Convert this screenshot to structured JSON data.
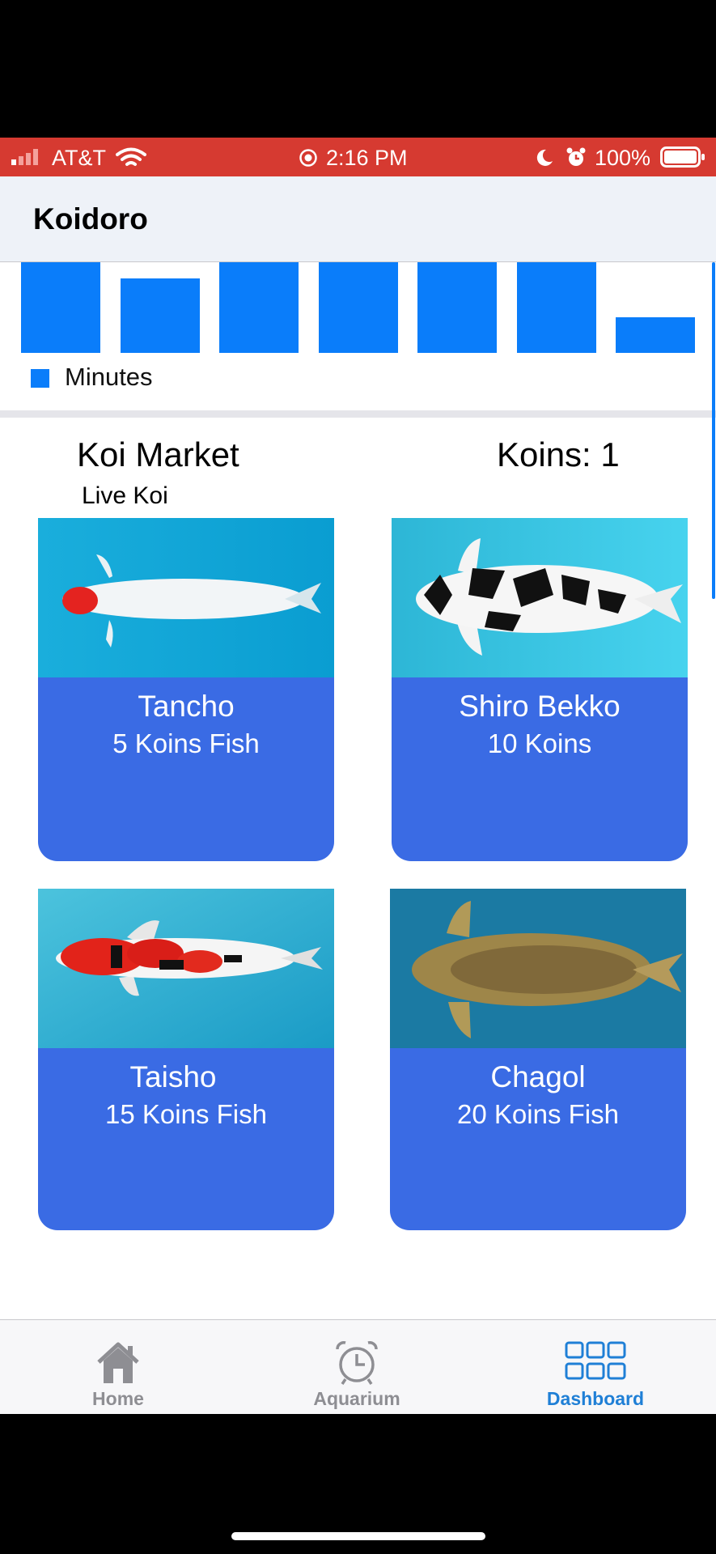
{
  "status_bar": {
    "carrier": "AT&T",
    "time": "2:16 PM",
    "battery": "100%",
    "icons": [
      "signal-icon",
      "wifi-icon",
      "location-icon",
      "moon-icon",
      "alarm-icon",
      "battery-icon"
    ]
  },
  "nav": {
    "title": "Koidoro"
  },
  "chart_data": {
    "type": "bar",
    "categories": [
      "",
      "",
      "",
      "",
      "",
      "",
      ""
    ],
    "series": [
      {
        "name": "Minutes",
        "values": [
          1.0,
          0.82,
          1.0,
          1.0,
          1.0,
          1.0,
          0.39
        ]
      }
    ],
    "legend": "bottom-left",
    "color": "#0a7dfa"
  },
  "market": {
    "title": "Koi Market",
    "koins_label": "Koins: 1",
    "section": "Live Koi",
    "items": [
      {
        "name": "Tancho",
        "price": "5 Koins Fish"
      },
      {
        "name": "Shiro Bekko",
        "price": "10 Koins"
      },
      {
        "name": "Taisho",
        "price": "15 Koins Fish"
      },
      {
        "name": "Chagol",
        "price": "20 Koins Fish"
      }
    ]
  },
  "tabbar": {
    "tabs": [
      {
        "label": "Home",
        "icon": "house-icon",
        "active": false
      },
      {
        "label": "Aquarium",
        "icon": "alarm-clock-icon",
        "active": false
      },
      {
        "label": "Dashboard",
        "icon": "grid-icon",
        "active": true
      }
    ],
    "active_color": "#1f7fd6",
    "inactive_color": "#8e8e93"
  }
}
